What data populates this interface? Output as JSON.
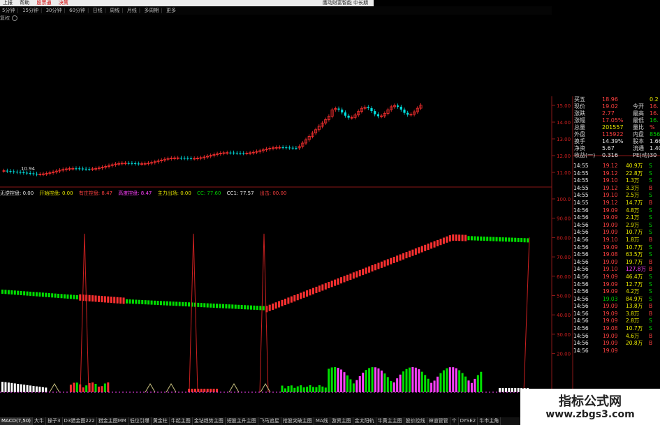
{
  "menubar": {
    "items": [
      "上报",
      "帮助",
      "股票通",
      "决策"
    ],
    "right_text": "鹰动财富智能 中长期"
  },
  "periods": [
    "5分钟",
    "15分钟",
    "30分钟",
    "60分钟",
    "日线",
    "周线",
    "月线",
    "多周期",
    "更多"
  ],
  "subbar": {
    "label": "复权"
  },
  "price_axis": [
    "15.00",
    "14.00",
    "13.00",
    "12.00",
    "11.00"
  ],
  "price_low_label": "10.94",
  "indicator_axis": [
    "100.0",
    "90.00",
    "80.00",
    "70.00",
    "60.00",
    "50.00",
    "40.00",
    "30.00",
    "20.00"
  ],
  "indicator_line": [
    {
      "text": "无逆控盘: 0.00",
      "color": "#e8e8e8"
    },
    {
      "text": "开始控盘: 0.00",
      "color": "#e8e800"
    },
    {
      "text": "有庄控盘: 8.47",
      "color": "#ff4040"
    },
    {
      "text": "高度控盘: 8.47",
      "color": "#ff40ff"
    },
    {
      "text": "主力出场: 0.00",
      "color": "#e8e800"
    },
    {
      "text": "CC: 77.60",
      "color": "#00d000"
    },
    {
      "text": "CC1: 77.57",
      "color": "#e8e8e8"
    },
    {
      "text": "出击: 00.00",
      "color": "#ff4040"
    }
  ],
  "bottom_tabs": [
    "MACD(7,50)",
    "大牛",
    "操子3",
    "D3猎金图222",
    "猎金主图MM",
    "低位引爆",
    "黄金柱",
    "牛起主图",
    "金钻趋势主图",
    "短股主升主图",
    "飞马追星",
    "抢股突破主图",
    "MA线",
    "游资主图",
    "金太阳轨",
    "牛黄主主图",
    "股价控线",
    "神道管管",
    "个",
    "DYSE2",
    "牛市主角"
  ],
  "quote": {
    "rows": [
      {
        "label": "买五",
        "value": "18.96",
        "value_color": "#ff4040",
        "label2": "",
        "value2": "0.2",
        "value2_color": "#e8e800"
      },
      {
        "label": "现价",
        "value": "19.02",
        "value_color": "#ff4040",
        "label2": "今开",
        "value2": "16.",
        "value2_color": "#ff4040"
      },
      {
        "label": "涨跌",
        "value": "2.77",
        "value_color": "#ff4040",
        "label2": "最高",
        "value2": "16.",
        "value2_color": "#ff4040"
      },
      {
        "label": "涨幅",
        "value": "17.05%",
        "value_color": "#ff4040",
        "label2": "最低",
        "value2": "16.",
        "value2_color": "#00d000"
      },
      {
        "label": "总量",
        "value": "201557",
        "value_color": "#e8e800",
        "label2": "量比",
        "value2": "%",
        "value2_color": "#ff4040"
      },
      {
        "label": "外盘",
        "value": "115922",
        "value_color": "#ff4040",
        "label2": "内盘",
        "value2": "856",
        "value2_color": "#00d000"
      },
      {
        "label": "换手",
        "value": "14.39%",
        "value_color": "#e8e8e8",
        "label2": "股本",
        "value2": "1.66",
        "value2_color": "#e8e8e8"
      },
      {
        "label": "净资",
        "value": "5.67",
        "value_color": "#e8e8e8",
        "label2": "流通",
        "value2": "1.40",
        "value2_color": "#e8e8e8"
      },
      {
        "label": "收益(一)",
        "value": "0.316",
        "value_color": "#e8e8e8",
        "label2": "PE(动)",
        "value2": "30",
        "value2_color": "#e8e8e8"
      }
    ]
  },
  "ticks": [
    {
      "time": "14:55",
      "price": "19.12",
      "vol": "40.9万",
      "side": "S"
    },
    {
      "time": "14:55",
      "price": "19.12",
      "vol": "22.8万",
      "side": "S"
    },
    {
      "time": "14:55",
      "price": "19.10",
      "vol": "1.3万",
      "side": "S"
    },
    {
      "time": "14:55",
      "price": "19.12",
      "vol": "3.3万",
      "side": "B"
    },
    {
      "time": "14:55",
      "price": "19.10",
      "vol": "2.5万",
      "side": "S"
    },
    {
      "time": "14:55",
      "price": "19.12",
      "vol": "14.7万",
      "side": "B"
    },
    {
      "time": "14:56",
      "price": "19.09",
      "vol": "4.8万",
      "side": "S"
    },
    {
      "time": "14:56",
      "price": "19.09",
      "vol": "2.1万",
      "side": "S"
    },
    {
      "time": "14:56",
      "price": "19.09",
      "vol": "2.9万",
      "side": "S"
    },
    {
      "time": "14:56",
      "price": "19.09",
      "vol": "10.7万",
      "side": "S"
    },
    {
      "time": "14:56",
      "price": "19.10",
      "vol": "1.8万",
      "side": "B"
    },
    {
      "time": "14:56",
      "price": "19.09",
      "vol": "10.7万",
      "side": "S"
    },
    {
      "time": "14:56",
      "price": "19.08",
      "vol": "63.5万",
      "side": "S"
    },
    {
      "time": "14:56",
      "price": "19.09",
      "vol": "19.7万",
      "side": "B"
    },
    {
      "time": "14:56",
      "price": "19.10",
      "vol": "127.8万",
      "side": "B"
    },
    {
      "time": "14:56",
      "price": "19.09",
      "vol": "46.4万",
      "side": "S"
    },
    {
      "time": "14:56",
      "price": "19.09",
      "vol": "12.7万",
      "side": "S"
    },
    {
      "time": "14:56",
      "price": "19.09",
      "vol": "4.2万",
      "side": "S"
    },
    {
      "time": "14:56",
      "price": "19.03",
      "vol": "84.9万",
      "side": "S"
    },
    {
      "time": "14:56",
      "price": "19.09",
      "vol": "13.8万",
      "side": "B"
    },
    {
      "time": "14:56",
      "price": "19.09",
      "vol": "3.8万",
      "side": "B"
    },
    {
      "time": "14:56",
      "price": "19.09",
      "vol": "2.8万",
      "side": "S"
    },
    {
      "time": "14:56",
      "price": "19.08",
      "vol": "10.7万",
      "side": "S"
    },
    {
      "time": "14:56",
      "price": "19.09",
      "vol": "4.6万",
      "side": "B"
    },
    {
      "time": "14:56",
      "price": "19.09",
      "vol": "20.8万",
      "side": "B"
    },
    {
      "time": "14:56",
      "price": "19.09",
      "vol": "",
      "side": ""
    }
  ],
  "watermark": {
    "title": "指标公式网",
    "url": "www.zbgs3.com"
  },
  "colors": {
    "up": "#ff3030",
    "down": "#00e0e0",
    "lime": "#00e000",
    "magenta": "#ff40ff",
    "axis": "#8a1818"
  }
}
